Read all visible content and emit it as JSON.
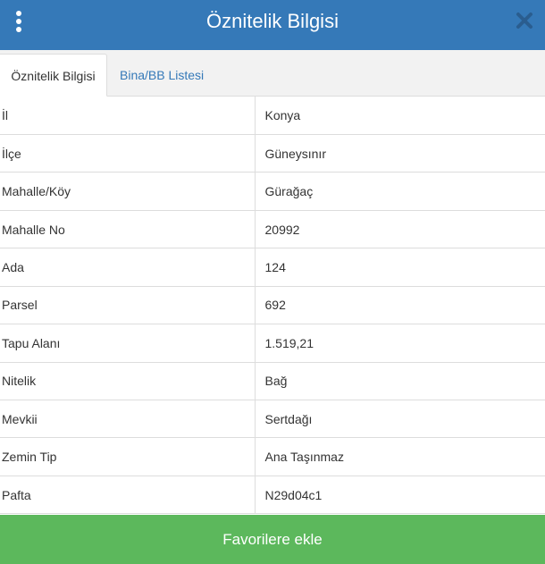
{
  "header": {
    "title": "Öznitelik Bilgisi",
    "menu_icon": "vertical-ellipsis-icon",
    "close_icon": "close-icon"
  },
  "tabs": [
    {
      "label": "Öznitelik Bilgisi",
      "active": true
    },
    {
      "label": "Bina/BB Listesi",
      "active": false
    }
  ],
  "attributes": [
    {
      "key": "İl",
      "value": "Konya"
    },
    {
      "key": "İlçe",
      "value": "Güneysınır"
    },
    {
      "key": "Mahalle/Köy",
      "value": "Gürağaç"
    },
    {
      "key": "Mahalle No",
      "value": "20992"
    },
    {
      "key": "Ada",
      "value": "124"
    },
    {
      "key": "Parsel",
      "value": "692"
    },
    {
      "key": "Tapu Alanı",
      "value": "1.519,21"
    },
    {
      "key": "Nitelik",
      "value": "Bağ"
    },
    {
      "key": "Mevkii",
      "value": "Sertdağı"
    },
    {
      "key": "Zemin Tip",
      "value": "Ana Taşınmaz"
    },
    {
      "key": "Pafta",
      "value": "N29d04c1"
    }
  ],
  "footer": {
    "favorite_label": "Favorilere ekle"
  },
  "colors": {
    "header_bg": "#3579b8",
    "button_bg": "#5cb85c",
    "close_icon": "#2a5d8f",
    "tab_link": "#3579b8"
  }
}
